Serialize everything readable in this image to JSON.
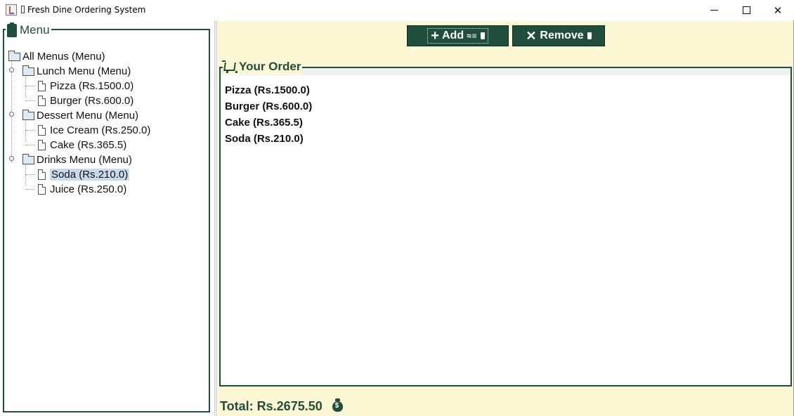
{
  "window": {
    "title": "Fresh Dine Ordering System",
    "minimize_glyph": "",
    "maximize_glyph": "",
    "close_glyph": "✕"
  },
  "colors": {
    "accent": "#1f4e3d",
    "right_panel_bg": "#fdf8d4",
    "selection": "#c9d8ea"
  },
  "menu_panel": {
    "title": "Menu",
    "icon": "clipboard-icon",
    "tree": {
      "root": "All Menus (Menu)",
      "groups": [
        {
          "label": "Lunch Menu (Menu)",
          "items": [
            "Pizza (Rs.1500.0)",
            "Burger (Rs.600.0)"
          ]
        },
        {
          "label": "Dessert Menu (Menu)",
          "items": [
            "Ice Cream (Rs.250.0)",
            "Cake (Rs.365.5)"
          ]
        },
        {
          "label": "Drinks Menu (Menu)",
          "items": [
            "Soda (Rs.210.0)",
            "Juice (Rs.250.0)"
          ]
        }
      ],
      "selected": "Soda (Rs.210.0)"
    }
  },
  "toolbar": {
    "add_label": "Add",
    "remove_label": "Remove"
  },
  "order_panel": {
    "title": "Your Order",
    "icon": "cart-icon",
    "items": [
      "Pizza (Rs.1500.0)",
      "Burger (Rs.600.0)",
      "Cake (Rs.365.5)",
      "Soda (Rs.210.0)"
    ]
  },
  "total": {
    "text": "Total: Rs.2675.50",
    "icon": "moneybag-icon"
  }
}
